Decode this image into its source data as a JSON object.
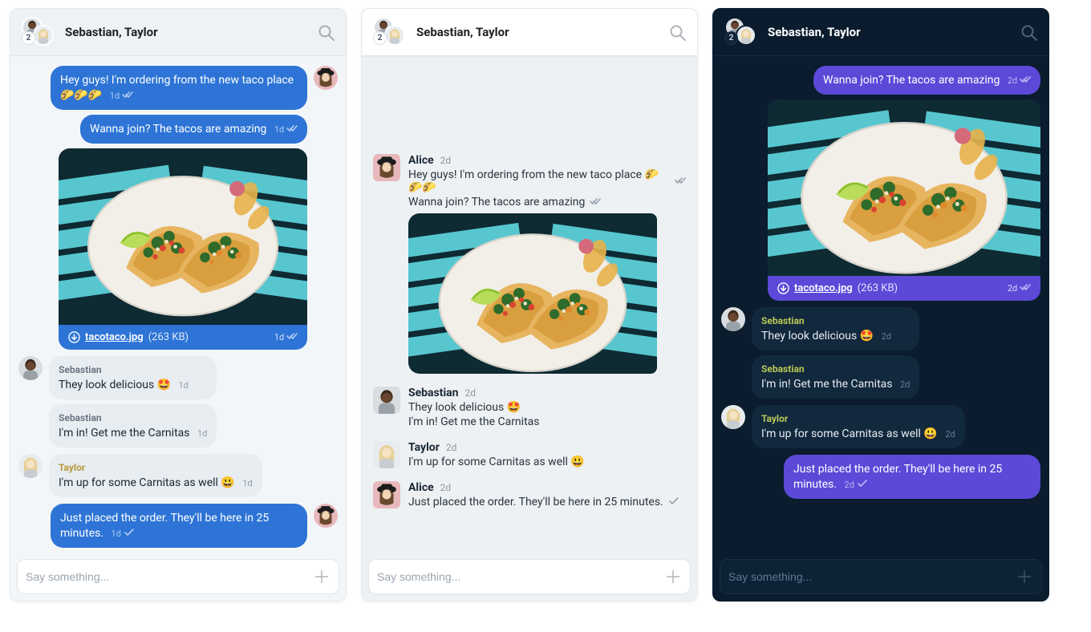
{
  "header": {
    "title": "Sebastian, Taylor",
    "member_count": "2"
  },
  "composer": {
    "placeholder": "Say something..."
  },
  "attachment": {
    "filename": "tacotaco.jpg",
    "filesize": "(263 KB)"
  },
  "people": {
    "alice": "Alice",
    "sebastian": "Sebastian",
    "taylor": "Taylor"
  },
  "timestamps": {
    "a": "1d",
    "b": "2d",
    "c": "2d"
  },
  "messages": {
    "m1": "Hey guys! I'm ordering from the new taco place 🌮🌮🌮",
    "m1_flat": "Hey guys! I'm ordering from the new taco place 🌮🌮🌮",
    "m2": "Wanna join? The tacos are amazing",
    "m3": "They look delicious 🤩",
    "m4": "I'm in! Get me the Carnitas",
    "m5": "I'm up for some Carnitas as well 😃",
    "m6": "Just placed the order. They'll be here in 25 minutes."
  }
}
